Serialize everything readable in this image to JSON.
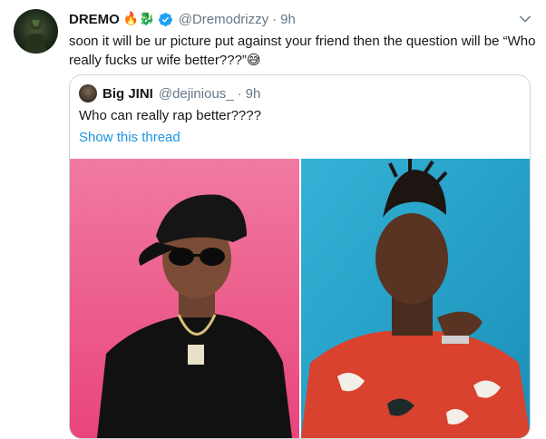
{
  "tweet": {
    "author_name": "DREMO",
    "author_emojis": "🔥🐉",
    "handle": "@Dremodrizzy",
    "separator": "·",
    "time": "9h",
    "text": "soon it will be ur picture put against your friend then the question will be “Who really fucks ur wife better???”",
    "text_emoji": "😅"
  },
  "quoted_tweet": {
    "author_name": "Big JINI",
    "handle": "@dejinious_",
    "separator": "·",
    "time": "9h",
    "text": "Who can really rap better????",
    "show_thread_label": "Show this thread"
  },
  "colors": {
    "link": "#1b95e0",
    "secondary_text": "#657786",
    "verified": "#1da1f2",
    "left_photo_bg": "#f0608e",
    "right_photo_bg": "#2aa3c9"
  },
  "icons": [
    "verified-badge-icon",
    "chevron-down-icon"
  ]
}
